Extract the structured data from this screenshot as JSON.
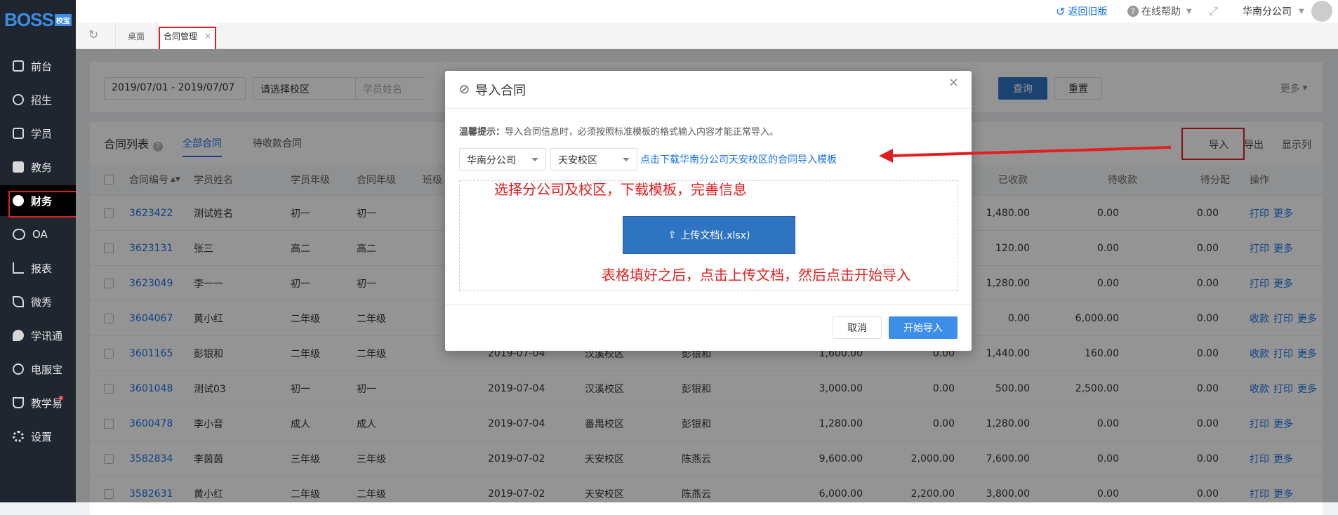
{
  "app": {
    "logo": "BOSS",
    "logo_badge": "校宝"
  },
  "sidebar": {
    "items": [
      {
        "label": "前台",
        "icon": "calendar-icon"
      },
      {
        "label": "招生",
        "icon": "user-add-icon"
      },
      {
        "label": "学员",
        "icon": "id-card-icon"
      },
      {
        "label": "教务",
        "icon": "book-icon"
      },
      {
        "label": "财务",
        "icon": "yen-icon"
      },
      {
        "label": "OA",
        "icon": "toggle-icon"
      },
      {
        "label": "报表",
        "icon": "bar-chart-icon"
      },
      {
        "label": "微秀",
        "icon": "xiu-icon"
      },
      {
        "label": "学讯通",
        "icon": "location-pin-icon"
      },
      {
        "label": "电服宝",
        "icon": "phone-icon"
      },
      {
        "label": "教学易",
        "icon": "teach-icon"
      },
      {
        "label": "设置",
        "icon": "gear-icon"
      }
    ]
  },
  "header": {
    "back_old": "返回旧版",
    "help": "在线帮助",
    "company": "华南分公司"
  },
  "tabs": {
    "desktop": "桌面",
    "contract": "合同管理",
    "close": "×"
  },
  "filters": {
    "date_range": "2019/07/01 - 2019/07/07",
    "campus_placeholder": "请选择校区",
    "student_placeholder": "学员姓名",
    "query": "查询",
    "reset": "重置",
    "more": "更多"
  },
  "list": {
    "title": "合同列表",
    "tab_all": "全部合同",
    "tab_pending": "待收款合同",
    "import": "导入",
    "export": "导出",
    "columns_toggle": "显示列",
    "columns": [
      "合同编号",
      "学员姓名",
      "学员年级",
      "合同年级",
      "班级",
      "已收款",
      "待收款",
      "待分配",
      "操作"
    ],
    "rows": [
      {
        "id": "3623422",
        "name": "测试姓名",
        "sgrade": "初一",
        "cgrade": "初一",
        "date": "",
        "campus": "",
        "staff": "",
        "total": "",
        "discount": "",
        "paid": "1,480.00",
        "due": "0.00",
        "alloc": "0.00",
        "ops": [
          "打印",
          "更多"
        ]
      },
      {
        "id": "3623131",
        "name": "张三",
        "sgrade": "高二",
        "cgrade": "高二",
        "date": "",
        "campus": "",
        "staff": "",
        "total": "",
        "discount": "",
        "paid": "120.00",
        "due": "0.00",
        "alloc": "0.00",
        "ops": [
          "打印",
          "更多"
        ]
      },
      {
        "id": "3623049",
        "name": "李一一",
        "sgrade": "初一",
        "cgrade": "初一",
        "date": "",
        "campus": "",
        "staff": "",
        "total": "",
        "discount": "",
        "paid": "1,280.00",
        "due": "0.00",
        "alloc": "0.00",
        "ops": [
          "打印",
          "更多"
        ]
      },
      {
        "id": "3604067",
        "name": "黄小红",
        "sgrade": "二年级",
        "cgrade": "二年级",
        "date": "",
        "campus": "",
        "staff": "",
        "total": "",
        "discount": "",
        "paid": "0.00",
        "due": "6,000.00",
        "alloc": "0.00",
        "ops": [
          "收款",
          "打印",
          "更多"
        ]
      },
      {
        "id": "3601165",
        "name": "彭银和",
        "sgrade": "二年级",
        "cgrade": "二年级",
        "date": "2019-07-04",
        "campus": "汉溪校区",
        "staff": "彭银和",
        "total": "1,600.00",
        "discount": "0.00",
        "paid": "1,440.00",
        "due": "160.00",
        "alloc": "0.00",
        "ops": [
          "收款",
          "打印",
          "更多"
        ]
      },
      {
        "id": "3601048",
        "name": "测试03",
        "sgrade": "初一",
        "cgrade": "初一",
        "date": "2019-07-04",
        "campus": "汉溪校区",
        "staff": "彭银和",
        "total": "3,000.00",
        "discount": "0.00",
        "paid": "500.00",
        "due": "2,500.00",
        "alloc": "0.00",
        "ops": [
          "收款",
          "打印",
          "更多"
        ]
      },
      {
        "id": "3600478",
        "name": "李小音",
        "sgrade": "成人",
        "cgrade": "成人",
        "date": "2019-07-04",
        "campus": "番禺校区",
        "staff": "彭银和",
        "total": "1,280.00",
        "discount": "0.00",
        "paid": "1,280.00",
        "due": "0.00",
        "alloc": "0.00",
        "ops": [
          "打印",
          "更多"
        ]
      },
      {
        "id": "3582834",
        "name": "李茵茵",
        "sgrade": "三年级",
        "cgrade": "三年级",
        "date": "2019-07-02",
        "campus": "天安校区",
        "staff": "陈燕云",
        "total": "9,600.00",
        "discount": "2,000.00",
        "paid": "7,600.00",
        "due": "0.00",
        "alloc": "0.00",
        "ops": [
          "打印",
          "更多"
        ]
      },
      {
        "id": "3582631",
        "name": "黄小红",
        "sgrade": "二年级",
        "cgrade": "二年级",
        "date": "2019-07-02",
        "campus": "天安校区",
        "staff": "陈燕云",
        "total": "6,000.00",
        "discount": "2,200.00",
        "paid": "3,800.00",
        "due": "0.00",
        "alloc": "0.00",
        "ops": [
          "打印",
          "更多"
        ]
      }
    ]
  },
  "modal": {
    "title": "导入合同",
    "close": "×",
    "tip_label": "温馨提示：",
    "tip_text": "导入合同信息时，必须按照标准模板的格式输入内容才能正常导入。",
    "company": "华南分公司",
    "campus": "天安校区",
    "download_link": "点击下载华南分公司天安校区的合同导入模板",
    "upload": "上传文档(.xlsx)",
    "cancel": "取消",
    "start": "开始导入"
  },
  "annotations": {
    "a1": "选择分公司及校区，下载模板，完善信息",
    "a2": "表格填好之后，点击上传文档，然后点击开始导入"
  }
}
